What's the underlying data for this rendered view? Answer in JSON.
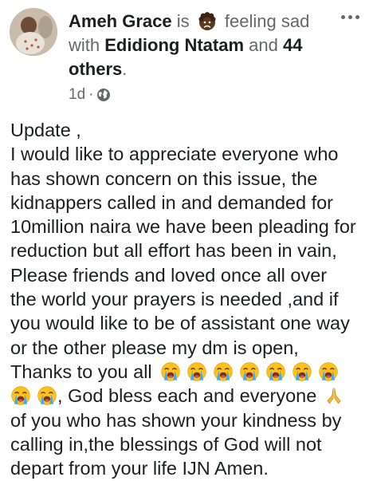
{
  "post": {
    "author": "Ameh Grace",
    "is_text": "is",
    "feeling_text": "feeling sad",
    "with_text": "with",
    "tagged_person": "Edidiong Ntatam",
    "and_text": "and",
    "others_text": "44 others",
    "period": ".",
    "timestamp": "1d",
    "separator": "·",
    "privacy_icon": "globe-icon",
    "feeling_icon": "sad-face-icon",
    "more_icon": "more-options-icon",
    "body_lines": [
      "Update ,",
      "I would like to appreciate everyone who",
      "has shown concern on this issue, the",
      "kidnappers called in and demanded for",
      "10million naira we have been pleading for",
      "reduction but all effort has been in vain,",
      "Please friends and loved once all over",
      "the world your prayers is needed ,and if",
      "you would like to be of assistant one way",
      "or the other please my dm is open,"
    ],
    "thanks_text": "Thanks to you all",
    "crying_emoji": "loudly-crying-face-icon",
    "bless_text": ", God bless each and everyone",
    "praying_emoji": "folded-hands-icon",
    "closing_lines": [
      "of you who has shown your kindness by",
      "calling in,the blessings of God will not",
      "depart from your life IJN Amen."
    ]
  },
  "colors": {
    "text": "#1c1e21",
    "secondary_text": "#65676b",
    "emoji_yellow": "#fcc21b",
    "tears": "#3fa9f5"
  }
}
